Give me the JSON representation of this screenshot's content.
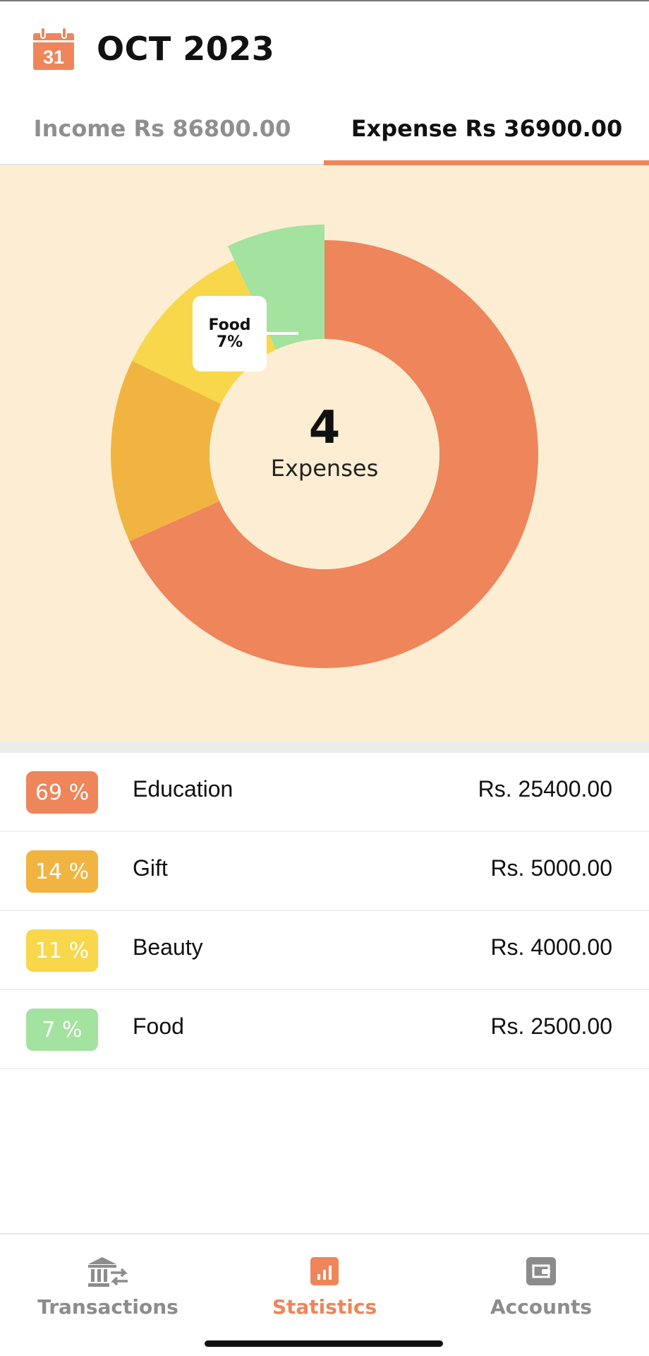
{
  "header": {
    "calendar_day": "31",
    "title": "OCT 2023",
    "icon": "calendar-icon"
  },
  "tabs": {
    "income_label": "Income Rs 86800.00",
    "expense_label": "Expense Rs 36900.00",
    "active": "expense"
  },
  "chart_data": {
    "type": "pie",
    "donut": true,
    "center_value": "4",
    "center_label": "Expenses",
    "categories": [
      "Education",
      "Gift",
      "Beauty",
      "Food"
    ],
    "values": [
      69,
      14,
      11,
      7
    ],
    "colors": [
      "#ee855b",
      "#f2b441",
      "#f8d74b",
      "#a3e29f"
    ],
    "highlighted": "Food",
    "tooltip": {
      "title": "Food",
      "value": "7%"
    }
  },
  "breakdown": [
    {
      "percent": "69 %",
      "category": "Education",
      "amount": "Rs. 25400.00",
      "color": "#ee855b"
    },
    {
      "percent": "14 %",
      "category": "Gift",
      "amount": "Rs. 5000.00",
      "color": "#f2b441"
    },
    {
      "percent": "11 %",
      "category": "Beauty",
      "amount": "Rs. 4000.00",
      "color": "#f8d74b"
    },
    {
      "percent": "7 %",
      "category": "Food",
      "amount": "Rs. 2500.00",
      "color": "#a3e29f"
    }
  ],
  "nav": {
    "items": [
      {
        "label": "Transactions",
        "icon": "transactions-icon"
      },
      {
        "label": "Statistics",
        "icon": "statistics-icon"
      },
      {
        "label": "Accounts",
        "icon": "wallet-icon"
      }
    ],
    "active": "Statistics"
  },
  "theme": {
    "accent": "#ee855b",
    "chart_background": "#fdeed3"
  }
}
